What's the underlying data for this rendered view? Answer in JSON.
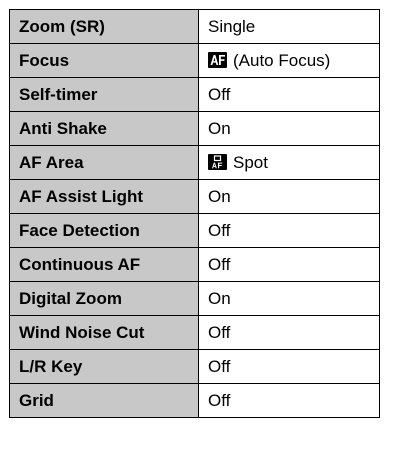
{
  "settings": [
    {
      "name": "Zoom (SR)",
      "value": "Single",
      "icon": null
    },
    {
      "name": "Focus",
      "value": "(Auto Focus)",
      "icon": "af-auto-focus-icon"
    },
    {
      "name": "Self-timer",
      "value": "Off",
      "icon": null
    },
    {
      "name": "Anti Shake",
      "value": "On",
      "icon": null
    },
    {
      "name": "AF Area",
      "value": "Spot",
      "icon": "af-spot-icon"
    },
    {
      "name": "AF Assist Light",
      "value": "On",
      "icon": null
    },
    {
      "name": "Face Detection",
      "value": "Off",
      "icon": null
    },
    {
      "name": "Continuous AF",
      "value": "Off",
      "icon": null
    },
    {
      "name": "Digital Zoom",
      "value": "On",
      "icon": null
    },
    {
      "name": "Wind Noise Cut",
      "value": "Off",
      "icon": null
    },
    {
      "name": "L/R Key",
      "value": "Off",
      "icon": null
    },
    {
      "name": "Grid",
      "value": "Off",
      "icon": null
    }
  ],
  "colors": {
    "label_background": "#c8c8c8",
    "value_background": "#ffffff",
    "border": "#000000"
  }
}
